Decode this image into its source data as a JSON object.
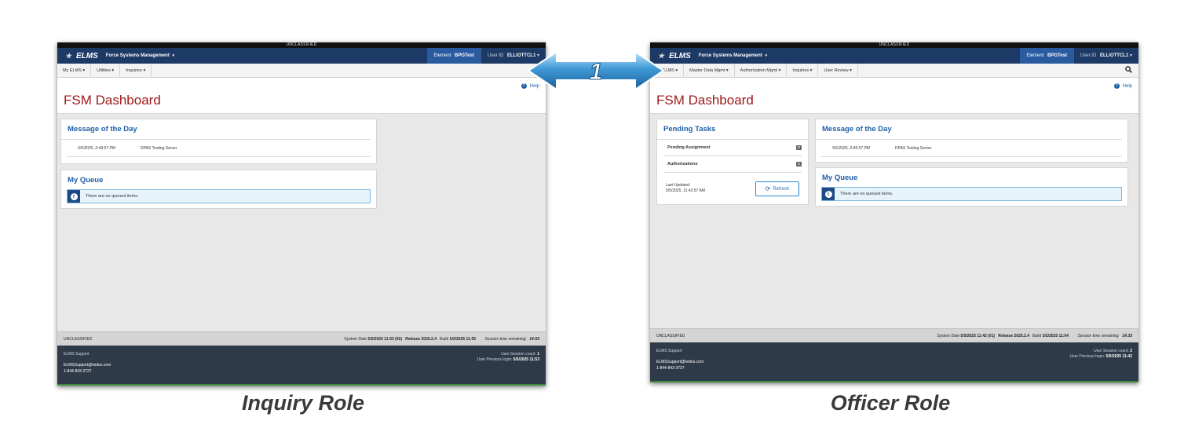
{
  "classification_top": "UNCLASSIFIED",
  "app": {
    "logo_text": "ELMS",
    "title": "Force Systems Management",
    "caret": "▾",
    "element_label": "Element",
    "element_value": "BPGTest",
    "user_label": "User ID",
    "user_value": "ELLIOTTCL1"
  },
  "left": {
    "menu": [
      "My ELMS ▾",
      "Utilities ▾",
      "Inquiries ▾"
    ],
    "page_title": "FSM Dashboard",
    "help": "Help",
    "motd": {
      "title": "Message of the Day",
      "date": "5/6/2025, 2:49:57 PM",
      "text": "DPAS Testing Server"
    },
    "queue": {
      "title": "My Queue",
      "message": "There are no queued items."
    },
    "status": {
      "left": "UNCLASSIFIED",
      "system_date_label": "System Date",
      "system_date": "5/5/2025 11:53 (02)",
      "release_label": "Release",
      "release": "2025.2.4",
      "build_label": "Build",
      "build": "5/2/2025 11:05",
      "session_label": "Session time remaining:",
      "session": "14:55"
    },
    "footer": {
      "support": "ELMS Support",
      "email": "ELMSSupport@leidos.com",
      "phone": "1-844-843-3727",
      "session_count_label": "User Session count:",
      "session_count": "1",
      "prev_login_label": "User Previous login:",
      "prev_login": "5/5/2025 11:53"
    },
    "caption": "Inquiry Role"
  },
  "right": {
    "menu": [
      "My ELMS ▾",
      "Master Data Mgmt ▾",
      "Authorization Mgmt ▾",
      "Inquiries ▾",
      "User Review ▾"
    ],
    "page_title": "FSM Dashboard",
    "help": "Help",
    "tasks": {
      "title": "Pending Tasks",
      "items": [
        {
          "label": "Pending Assignment",
          "count": "0"
        },
        {
          "label": "Authorizations",
          "count": "1"
        }
      ],
      "last_updated_label": "Last Updated:",
      "last_updated": "5/5/2025, 11:42:57 AM",
      "refresh": "Refresh"
    },
    "motd": {
      "title": "Message of the Day",
      "date": "5/6/2025, 2:49:57 PM",
      "text": "DPAS Testing Server"
    },
    "queue": {
      "title": "My Queue",
      "message": "There are no queued items."
    },
    "status": {
      "left": "UNCLASSIFIED",
      "system_date_label": "System Date",
      "system_date": "5/5/2025 11:42 (01)",
      "release_label": "Release",
      "release": "2025.2.4",
      "build_label": "Build",
      "build": "5/2/2025 11:04",
      "session_label": "Session time remaining:",
      "session": "14:35"
    },
    "footer": {
      "support": "ELMS Support",
      "email": "ELMSSupport@leidos.com",
      "phone": "1-844-843-3727",
      "session_count_label": "User Session count:",
      "session_count": "2",
      "prev_login_label": "User Previous login:",
      "prev_login": "5/5/2025 11:42"
    },
    "caption": "Officer Role"
  },
  "compare_arrow": {
    "label": "1",
    "icon": "double-arrow-icon",
    "color": "#2a86c8"
  }
}
